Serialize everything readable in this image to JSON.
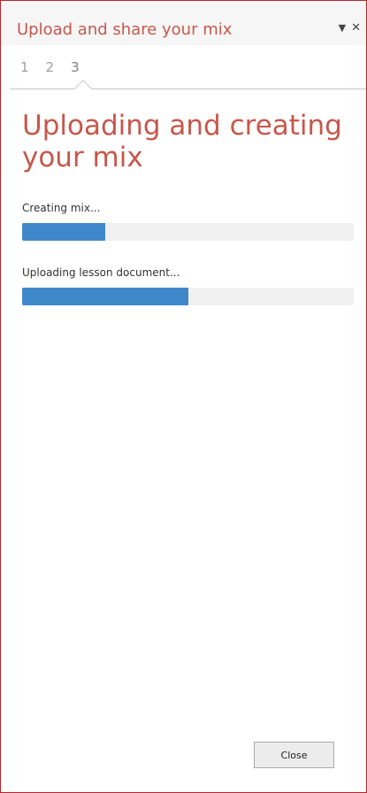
{
  "pane": {
    "title": "Upload and share your mix",
    "dropdown_icon": "chevron-down-icon",
    "close_icon": "close-icon"
  },
  "steps": [
    {
      "label": "1",
      "active": false
    },
    {
      "label": "2",
      "active": false
    },
    {
      "label": "3",
      "active": true
    }
  ],
  "main": {
    "heading": "Uploading and creating your mix",
    "progress": [
      {
        "label": "Creating mix...",
        "percent": 25
      },
      {
        "label": "Uploading lesson document...",
        "percent": 50
      }
    ]
  },
  "footer": {
    "close_label": "Close"
  },
  "colors": {
    "accent": "#c7574b",
    "progress_fill": "#3f89cb",
    "progress_track": "#f1f1f1",
    "pane_border": "#b3262e"
  }
}
